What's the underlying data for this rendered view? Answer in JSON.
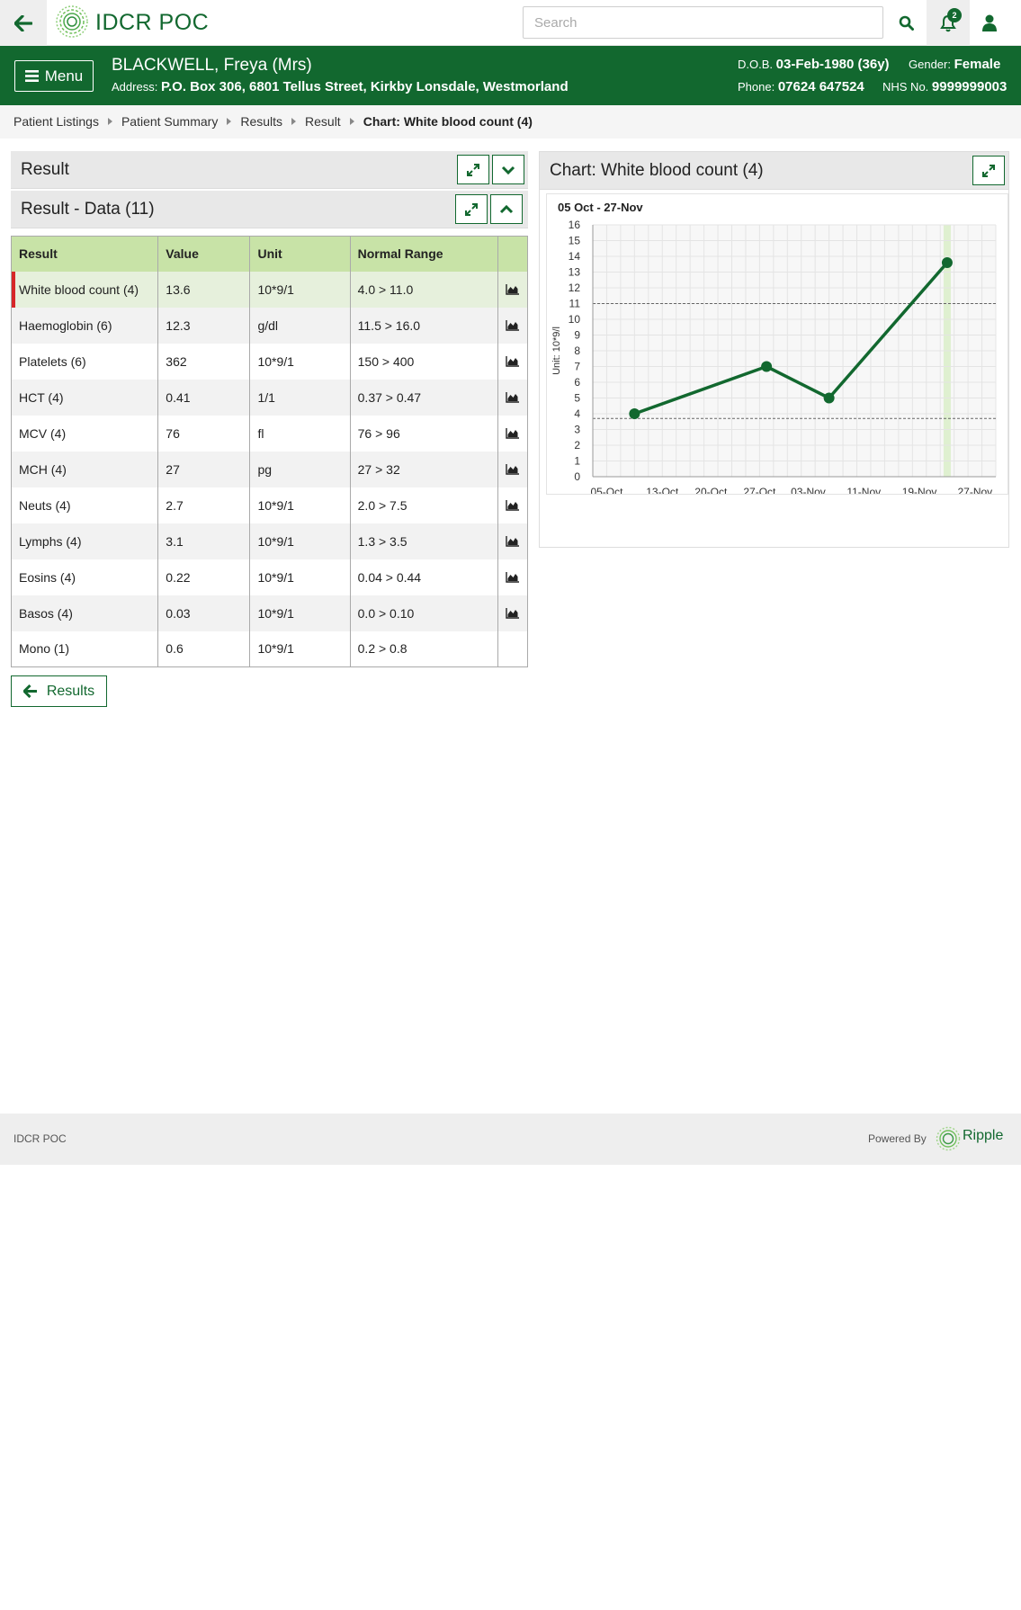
{
  "app": {
    "name": "IDCR POC"
  },
  "search": {
    "placeholder": "Search"
  },
  "notifications": {
    "count": "2"
  },
  "patient": {
    "name": "BLACKWELL, Freya (Mrs)",
    "address_label": "Address:",
    "address": "P.O. Box 306, 6801 Tellus Street, Kirkby Lonsdale, Westmorland",
    "dob_label": "D.O.B.",
    "dob": "03-Feb-1980 (36y)",
    "gender_label": "Gender:",
    "gender": "Female",
    "phone_label": "Phone:",
    "phone": "07624 647524",
    "nhs_label": "NHS No.",
    "nhs": "9999999003"
  },
  "menu": {
    "label": "Menu"
  },
  "breadcrumb": [
    "Patient Listings",
    "Patient Summary",
    "Results",
    "Result",
    "Chart: White blood count (4)"
  ],
  "result_panel": {
    "title": "Result"
  },
  "data_panel": {
    "title": "Result - Data (11)",
    "columns": [
      "Result",
      "Value",
      "Unit",
      "Normal Range",
      ""
    ],
    "rows": [
      {
        "result": "White blood count (4)",
        "value": "13.6",
        "unit": "10*9/1",
        "range": "4.0 > 11.0",
        "chart": true,
        "selected": true
      },
      {
        "result": "Haemoglobin (6)",
        "value": "12.3",
        "unit": "g/dl",
        "range": "11.5 > 16.0",
        "chart": true
      },
      {
        "result": "Platelets (6)",
        "value": "362",
        "unit": "10*9/1",
        "range": "150 > 400",
        "chart": true
      },
      {
        "result": "HCT (4)",
        "value": "0.41",
        "unit": "1/1",
        "range": "0.37 > 0.47",
        "chart": true
      },
      {
        "result": "MCV (4)",
        "value": "76",
        "unit": "fl",
        "range": "76 > 96",
        "chart": true
      },
      {
        "result": "MCH (4)",
        "value": "27",
        "unit": "pg",
        "range": "27 > 32",
        "chart": true
      },
      {
        "result": "Neuts (4)",
        "value": "2.7",
        "unit": "10*9/1",
        "range": "2.0 > 7.5",
        "chart": true
      },
      {
        "result": "Lymphs (4)",
        "value": "3.1",
        "unit": "10*9/1",
        "range": "1.3 > 3.5",
        "chart": true
      },
      {
        "result": "Eosins (4)",
        "value": "0.22",
        "unit": "10*9/1",
        "range": "0.04 > 0.44",
        "chart": true
      },
      {
        "result": "Basos (4)",
        "value": "0.03",
        "unit": "10*9/1",
        "range": "0.0 > 0.10",
        "chart": true
      },
      {
        "result": "Mono (1)",
        "value": "0.6",
        "unit": "10*9/1",
        "range": "0.2 > 0.8",
        "chart": false
      }
    ]
  },
  "back_button": {
    "label": "Results"
  },
  "chart_panel": {
    "title": "Chart: White blood count (4)"
  },
  "chart_data": {
    "type": "line",
    "subtitle": "05 Oct - 27-Nov",
    "ylabel": "Unit: 10*9/l",
    "ylim": [
      0,
      16
    ],
    "yticks": [
      0,
      1,
      2,
      3,
      4,
      5,
      6,
      7,
      8,
      9,
      10,
      11,
      12,
      13,
      14,
      15,
      16
    ],
    "xlim": [
      "2015-10-03",
      "2015-11-30"
    ],
    "xticks": [
      {
        "date": "2015-10-05",
        "label": "05-Oct"
      },
      {
        "date": "2015-10-13",
        "label": "13-Oct"
      },
      {
        "date": "2015-10-20",
        "label": "20-Oct"
      },
      {
        "date": "2015-10-27",
        "label": "27-Oct"
      },
      {
        "date": "2015-11-03",
        "label": "03-Nov"
      },
      {
        "date": "2015-11-11",
        "label": "11-Nov"
      },
      {
        "date": "2015-11-19",
        "label": "19-Nov"
      },
      {
        "date": "2015-11-27",
        "label": "27-Nov"
      }
    ],
    "series": [
      {
        "points": [
          {
            "x": "2015-10-09",
            "y": 4.0
          },
          {
            "x": "2015-10-28",
            "y": 7.0
          },
          {
            "x": "2015-11-06",
            "y": 5.0
          },
          {
            "x": "2015-11-23",
            "y": 13.6
          }
        ]
      }
    ],
    "reference_lines": [
      11.0,
      3.7
    ],
    "highlight_x": "2015-11-23",
    "grid": true,
    "line_color": "#12682f"
  },
  "footer": {
    "left": "IDCR POC",
    "powered_by": "Powered By",
    "ripple": "Ripple"
  }
}
